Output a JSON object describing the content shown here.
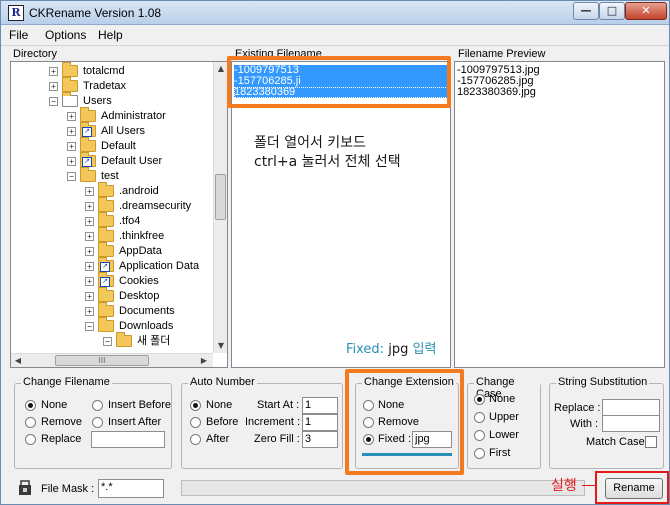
{
  "window": {
    "app_icon_letter": "R",
    "title": "CKRename Version 1.08",
    "controls": {
      "minimize": "—",
      "maximize": "□",
      "close": "✕"
    }
  },
  "menu": [
    "File",
    "Options",
    "Help"
  ],
  "directory": {
    "header": "Directory",
    "tree": [
      {
        "label": "totalcmd",
        "depth": 2,
        "expander": "+",
        "icon": "folder"
      },
      {
        "label": "Tradetax",
        "depth": 2,
        "expander": "+",
        "icon": "folder"
      },
      {
        "label": "Users",
        "depth": 2,
        "expander": "−",
        "icon": "user-folder"
      },
      {
        "label": "Administrator",
        "depth": 3,
        "expander": "+",
        "icon": "folder"
      },
      {
        "label": "All Users",
        "depth": 3,
        "expander": "+",
        "icon": "link-folder"
      },
      {
        "label": "Default",
        "depth": 3,
        "expander": "+",
        "icon": "folder"
      },
      {
        "label": "Default User",
        "depth": 3,
        "expander": "+",
        "icon": "link-folder"
      },
      {
        "label": "test",
        "depth": 3,
        "expander": "−",
        "icon": "folder"
      },
      {
        "label": ".android",
        "depth": 4,
        "expander": "+",
        "icon": "folder"
      },
      {
        "label": ".dreamsecurity",
        "depth": 4,
        "expander": "+",
        "icon": "folder"
      },
      {
        "label": ".tfo4",
        "depth": 4,
        "expander": "+",
        "icon": "folder"
      },
      {
        "label": ".thinkfree",
        "depth": 4,
        "expander": "+",
        "icon": "folder"
      },
      {
        "label": "AppData",
        "depth": 4,
        "expander": "+",
        "icon": "folder"
      },
      {
        "label": "Application Data",
        "depth": 4,
        "expander": "+",
        "icon": "link-folder"
      },
      {
        "label": "Cookies",
        "depth": 4,
        "expander": "+",
        "icon": "link-folder"
      },
      {
        "label": "Desktop",
        "depth": 4,
        "expander": "+",
        "icon": "folder"
      },
      {
        "label": "Documents",
        "depth": 4,
        "expander": "+",
        "icon": "folder"
      },
      {
        "label": "Downloads",
        "depth": 4,
        "expander": "−",
        "icon": "folder"
      },
      {
        "label": "새 폴더",
        "depth": 5,
        "expander": "−",
        "icon": "folder"
      }
    ],
    "hscroll_grip": "III"
  },
  "existing": {
    "header": "Existing Filename",
    "files": [
      "-1009797513",
      "-157706285.ji",
      "1823380369"
    ]
  },
  "preview": {
    "header": "Filename Preview",
    "files": [
      "-1009797513.jpg",
      "-157706285.jpg",
      "1823380369.jpg"
    ]
  },
  "annotation": {
    "line1": "폴더 열어서 키보드",
    "line2": "ctrl+a 눌러서 전체 선택",
    "fixed_note_a": "Fixed:",
    "fixed_note_b": "jpg",
    "fixed_note_c": "입력",
    "run_note": "실행"
  },
  "change_filename": {
    "title": "Change Filename",
    "options": [
      "None",
      "Remove",
      "Replace",
      "Insert Before",
      "Insert After"
    ],
    "selected": "None",
    "replace_value": ""
  },
  "auto_number": {
    "title": "Auto Number",
    "options": [
      "None",
      "Before",
      "After"
    ],
    "selected": "None",
    "start_at_label": "Start At :",
    "start_at": "1",
    "increment_label": "Increment :",
    "increment": "1",
    "zero_fill_label": "Zero Fill :",
    "zero_fill": "3"
  },
  "change_extension": {
    "title": "Change Extension",
    "options": [
      "None",
      "Remove",
      "Fixed :"
    ],
    "selected": "Fixed :",
    "fixed_value": "jpg"
  },
  "change_case": {
    "title": "Change Case",
    "options": [
      "None",
      "Upper",
      "Lower",
      "First"
    ],
    "selected": "None"
  },
  "string_substitution": {
    "title": "String Substitution",
    "replace_label": "Replace :",
    "replace_value": "",
    "with_label": "With :",
    "with_value": "",
    "match_case_label": "Match Case",
    "match_case": false
  },
  "footer": {
    "file_mask_label": "File Mask :",
    "file_mask": "*.*",
    "rename_button": "Rename"
  },
  "colors": {
    "selection": "#3399ff",
    "annotation_orange": "#f47a20",
    "annotation_red": "#e21a1a",
    "annotation_blue_text": "#2a8fb5"
  }
}
